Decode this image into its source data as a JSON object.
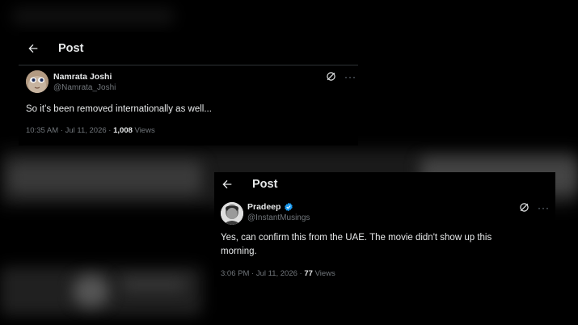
{
  "post_one": {
    "header_title": "Post",
    "author_name": "Namrata Joshi",
    "author_handle": "@Namrata_Joshi",
    "text": "So it’s been removed internationally as well...",
    "time": "10:35 AM",
    "date": "Jul 11, 2026",
    "views_count": "1,008",
    "views_label": "Views"
  },
  "post_two": {
    "header_title": "Post",
    "author_name": "Pradeep",
    "author_handle": "@InstantMusings",
    "verified": true,
    "text": "Yes, can confirm this from the UAE. The movie didn't show up this morning.",
    "time": "3:06 PM",
    "date": "Jul 11, 2026",
    "views_count": "77",
    "views_label": "Views"
  },
  "separator": " · ",
  "more_icon_text": "···",
  "colors": {
    "background": "#000000",
    "text_primary": "#e7e9ea",
    "text_secondary": "#71767b",
    "verified_blue": "#1d9bf0"
  },
  "icons": [
    "back-arrow-icon",
    "grok-icon",
    "more-icon",
    "verified-badge-icon"
  ]
}
